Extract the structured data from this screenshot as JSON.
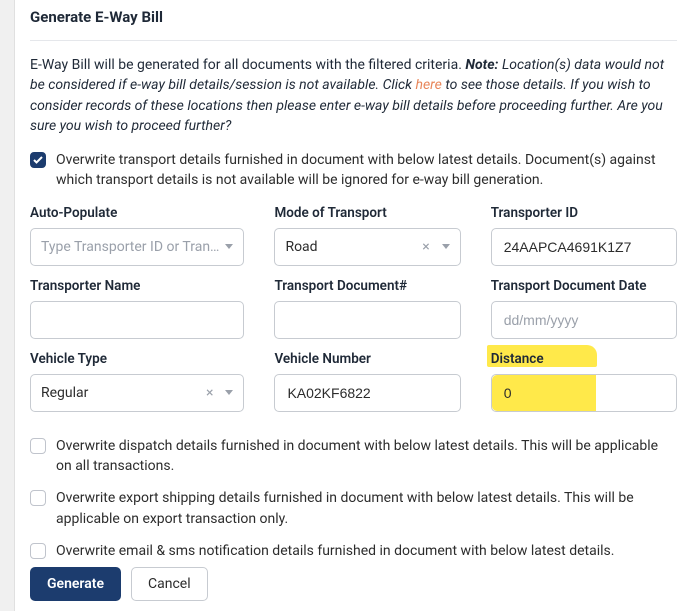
{
  "title": "Generate E-Way Bill",
  "intro_plain": "E-Way Bill will be generated for all documents with the filtered criteria.",
  "intro_note_label": "Note:",
  "intro_italic_1": "Location(s) data would not be considered if e-way bill details/session is not available. Click",
  "intro_link": "here",
  "intro_italic_2": "to see those details. If you wish to consider records of these locations then please enter e-way bill details before proceeding further. Are you sure you wish to proceed further?",
  "overwrite_transport_label": "Overwrite transport details furnished in document with below latest details. Document(s) against which transport details is not available will be ignored for e-way bill generation.",
  "fields": {
    "auto_populate": {
      "label": "Auto-Populate",
      "placeholder": "Type Transporter ID or Tran…"
    },
    "mode": {
      "label": "Mode of Transport",
      "value": "Road"
    },
    "transporter_id": {
      "label": "Transporter ID",
      "value": "24AAPCA4691K1Z7"
    },
    "transporter_name": {
      "label": "Transporter Name",
      "value": ""
    },
    "doc_num": {
      "label": "Transport Document#",
      "value": ""
    },
    "doc_date": {
      "label": "Transport Document Date",
      "placeholder": "dd/mm/yyyy",
      "value": ""
    },
    "vehicle_type": {
      "label": "Vehicle Type",
      "value": "Regular"
    },
    "vehicle_number": {
      "label": "Vehicle Number",
      "value": "KA02KF6822"
    },
    "distance": {
      "label": "Distance",
      "value": "0"
    }
  },
  "checks": {
    "dispatch": "Overwrite dispatch details furnished in document with below latest details. This will be applicable on all transactions.",
    "export": "Overwrite export shipping details furnished in document with below latest details. This will be applicable on export transaction only.",
    "email": "Overwrite email & sms notification details furnished in document with below latest details."
  },
  "buttons": {
    "generate": "Generate",
    "cancel": "Cancel"
  }
}
